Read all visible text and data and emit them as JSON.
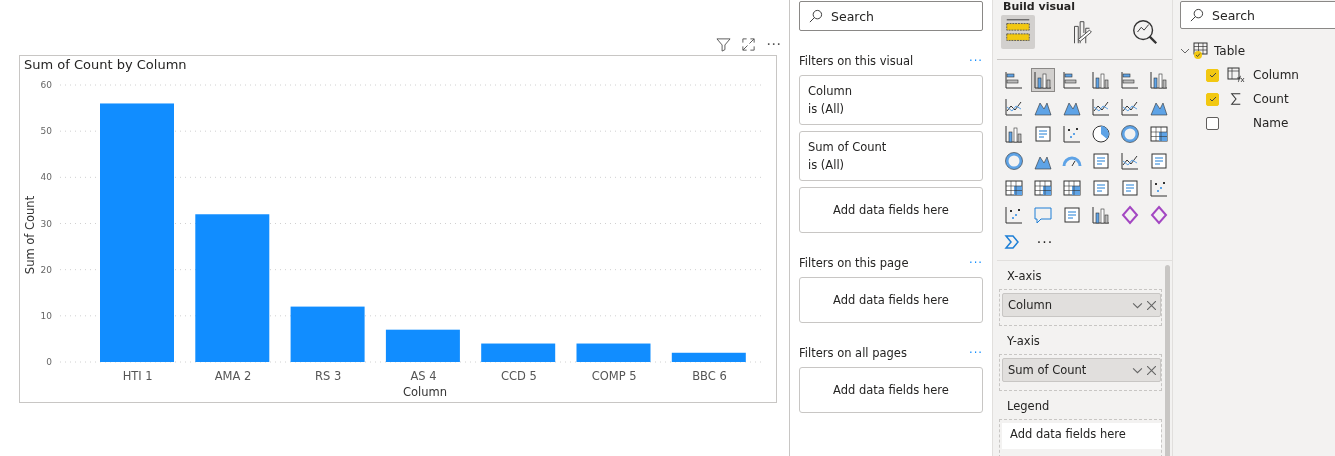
{
  "visual": {
    "header_more": "⋯",
    "title": "Sum of Count by Column",
    "chart_data": {
      "type": "bar",
      "xlabel": "Column",
      "ylabel": "Sum of Count",
      "categories": [
        "HTI 1",
        "AMA 2",
        "RS 3",
        "AS 4",
        "CCD 5",
        "COMP 5",
        "BBC 6"
      ],
      "series": [
        {
          "color": "#118dff",
          "values": [
            56,
            32,
            12,
            7,
            4,
            4,
            2
          ]
        }
      ],
      "grid": true,
      "ylim": [
        0,
        60
      ],
      "yticks": [
        0,
        10,
        20,
        30,
        40,
        50,
        60
      ]
    }
  },
  "filters": {
    "search": {
      "placeholder": "Search"
    },
    "sections": [
      {
        "title": "Filters on this visual",
        "more": "···",
        "cards": [
          {
            "kind": "filter",
            "name": "Column",
            "condition": "is (All)"
          },
          {
            "kind": "filter",
            "name": "Sum of Count",
            "condition": "is (All)"
          },
          {
            "kind": "drop",
            "text": "Add data fields here"
          }
        ]
      },
      {
        "title": "Filters on this page",
        "more": "···",
        "cards": [
          {
            "kind": "drop",
            "text": "Add data fields here"
          }
        ]
      },
      {
        "title": "Filters on all pages",
        "more": "···",
        "cards": [
          {
            "kind": "drop",
            "text": "Add data fields here"
          }
        ]
      }
    ]
  },
  "build": {
    "title": "Build visual",
    "tabs": [
      {
        "selected": true
      },
      {
        "selected": false
      },
      {
        "selected": false
      }
    ],
    "gallery": [
      {
        "selected": false
      },
      {
        "selected": true
      },
      {
        "selected": false
      },
      {
        "selected": false
      },
      {
        "selected": false
      },
      {
        "selected": false
      },
      {
        "selected": false
      },
      {
        "selected": false
      },
      {
        "selected": false
      },
      {
        "selected": false
      },
      {
        "selected": false
      },
      {
        "selected": false
      },
      {
        "selected": false
      },
      {
        "selected": false
      },
      {
        "selected": false
      },
      {
        "selected": false
      },
      {
        "selected": false
      },
      {
        "selected": false
      },
      {
        "selected": false
      },
      {
        "selected": false
      },
      {
        "selected": false
      },
      {
        "selected": false
      },
      {
        "selected": false
      },
      {
        "selected": false
      },
      {
        "selected": false
      },
      {
        "selected": false
      },
      {
        "selected": false
      },
      {
        "selected": false
      },
      {
        "selected": false
      },
      {
        "selected": false
      },
      {
        "selected": false
      },
      {
        "selected": false
      },
      {
        "selected": false
      },
      {
        "selected": false
      },
      {
        "selected": false
      },
      {
        "selected": false
      },
      {
        "selected": false
      }
    ],
    "gallery_more": "···",
    "wells": [
      {
        "label": "X-axis",
        "field": "Column"
      },
      {
        "label": "Y-axis",
        "field": "Sum of Count"
      },
      {
        "label": "Legend",
        "placeholder": "Add data fields here"
      }
    ]
  },
  "fields": {
    "search": {
      "placeholder": "Search"
    },
    "tree": [
      {
        "name": "Table",
        "expanded": true,
        "children": [
          {
            "name": "Column",
            "kind": "calc",
            "checked": true
          },
          {
            "name": "Count",
            "kind": "sum",
            "checked": true
          },
          {
            "name": "Name",
            "kind": "text",
            "checked": false
          }
        ]
      }
    ]
  }
}
